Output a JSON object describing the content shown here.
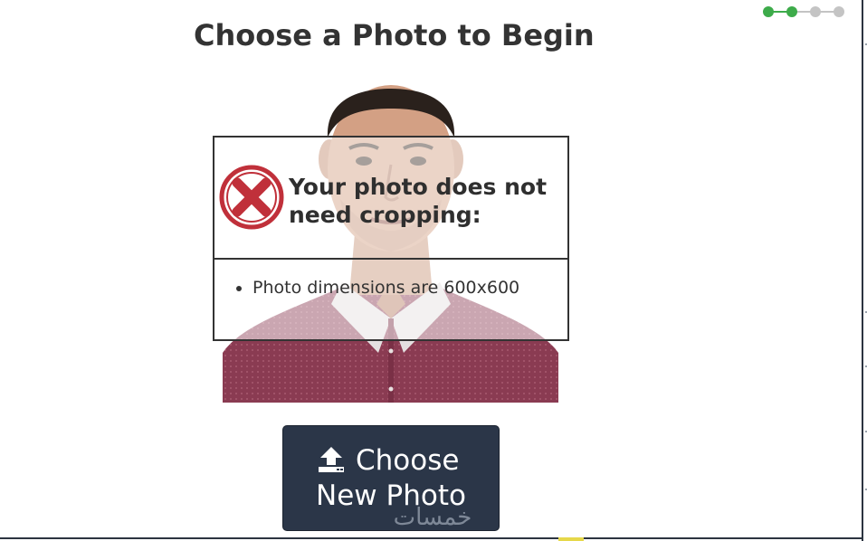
{
  "page": {
    "title": "Choose a Photo to Begin"
  },
  "progress": {
    "total_steps": 4,
    "completed_steps": 2,
    "complete_color": "#3dab4a",
    "pending_color": "#c4c4c4"
  },
  "photo": {
    "icon": "portrait-photo-icon"
  },
  "message": {
    "icon": "red-x-circle-icon",
    "icon_color": "#c0303a",
    "heading": "Your photo does not need cropping:",
    "items": [
      "Photo dimensions are 600x600"
    ]
  },
  "upload_button": {
    "icon": "upload-icon",
    "label_line1": "Choose",
    "label_line2": "New Photo",
    "background": "#2b3648"
  },
  "watermark": {
    "text": "خمسات"
  }
}
